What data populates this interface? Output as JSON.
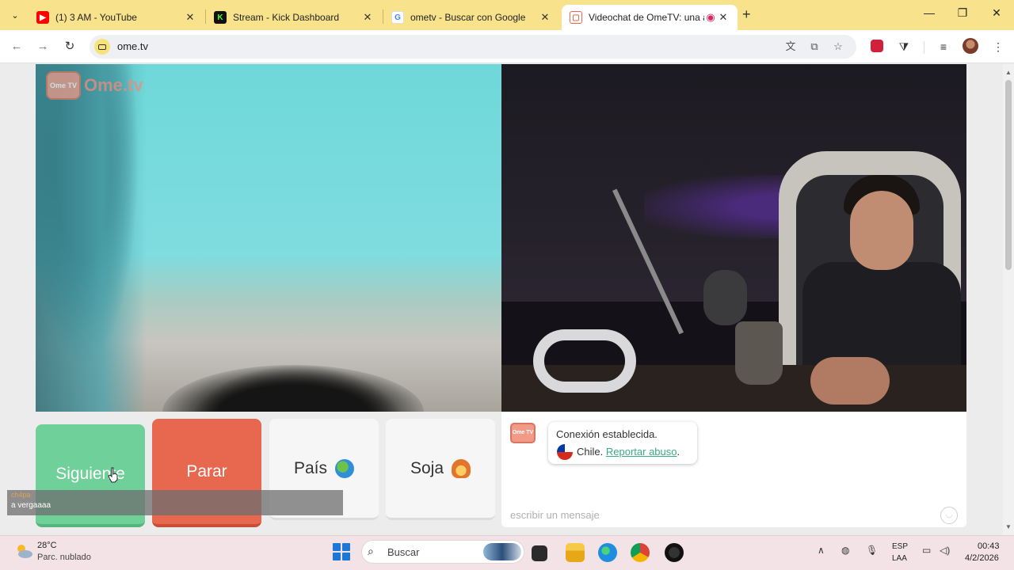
{
  "browser": {
    "tabs": [
      {
        "title": "(1) 3 AM - YouTube",
        "favicon": "youtube-icon",
        "color": "#ff0000"
      },
      {
        "title": "Stream - Kick Dashboard",
        "favicon": "kick-icon",
        "color": "#53fc18"
      },
      {
        "title": "ometv - Buscar con Google",
        "favicon": "google-icon",
        "color": "#4285f4"
      },
      {
        "title": "Videochat de OmeTV: una a",
        "favicon": "ometv-icon",
        "color": "#e8674f",
        "active": true
      }
    ],
    "url": "ome.tv"
  },
  "page": {
    "logo_text": "Ome.tv",
    "logo_badge": "Ome TV",
    "buttons": {
      "next": "Siguiente",
      "stop": "Parar",
      "country": "País",
      "gender": "Soja"
    },
    "chat": {
      "logo_badge": "Ome TV",
      "status": "Conexión establecida.",
      "country": "Chile.",
      "report_link": "Reportar abuso",
      "report_suffix": ".",
      "input_placeholder": "escribir un mensaje"
    },
    "overlay": {
      "user": "ch4pa",
      "message": "a vergaaaa"
    }
  },
  "taskbar": {
    "temperature": "28°C",
    "condition": "Parc. nublado",
    "search_placeholder": "Buscar",
    "lang_top": "ESP",
    "lang_bottom": "LAA",
    "time": "00:43",
    "date": "4/2/2026"
  },
  "colors": {
    "next": "#6fd09a",
    "stop": "#e8674f",
    "tabstrip": "#f8e38c",
    "link": "#3aaa86"
  }
}
